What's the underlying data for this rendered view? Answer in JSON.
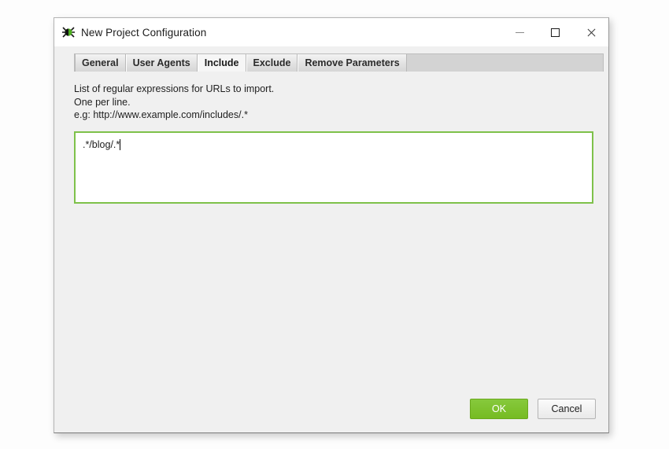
{
  "window": {
    "title": "New Project Configuration",
    "icon": "spider-logo-icon",
    "controls": {
      "minimize": "minimize-icon",
      "maximize": "maximize-icon",
      "close": "close-icon"
    }
  },
  "tabs": [
    {
      "label": "General",
      "active": false
    },
    {
      "label": "User Agents",
      "active": false
    },
    {
      "label": "Include",
      "active": true
    },
    {
      "label": "Exclude",
      "active": false
    },
    {
      "label": "Remove Parameters",
      "active": false
    }
  ],
  "include_panel": {
    "description_lines": [
      "List of regular expressions for URLs to import.",
      "One per line.",
      "e.g: http://www.example.com/includes/.*"
    ],
    "textarea_value": ".*/blog/.*",
    "textarea_placeholder": ""
  },
  "footer": {
    "ok_label": "OK",
    "cancel_label": "Cancel"
  },
  "colors": {
    "accent_green": "#76bb22",
    "field_border_green": "#7ec14a",
    "dialog_background": "#f0f0f0",
    "titlebar_background": "#ffffff",
    "tabstrip_background": "#d3d3d3"
  }
}
